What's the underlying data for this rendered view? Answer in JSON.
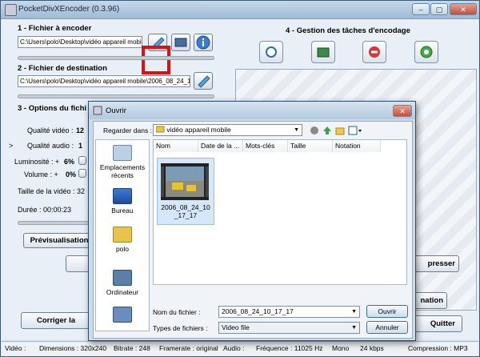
{
  "app": {
    "title": "PocketDivXEncoder (0.3.96)",
    "controls": {
      "min": "‒",
      "max": "▢",
      "close": "✕"
    }
  },
  "section1": {
    "title": "1 - Fichier à encoder",
    "path": "C:\\Users\\polo\\Desktop\\vidéo appareil mobile"
  },
  "section2": {
    "title": "2 - Fichier de destination",
    "path": "C:\\Users\\polo\\Desktop\\vidéo appareil mobile\\2006_08_24_1"
  },
  "section3": {
    "title": "3 - Options du fichi",
    "qualite_video_label": "Qualité vidéo :",
    "qualite_video_val": "12",
    "qualite_audio_label": "Qualité audio :",
    "qualite_audio_val": "1",
    "luminosite_label": "Luminosité : +",
    "luminosite_val": "6%",
    "volume_label": "Volume : +",
    "volume_val": "0%",
    "taille_label": "Taille de la vidéo : 32",
    "duree_label": "Durée : 00:00:23",
    "side_marker": ">"
  },
  "section4": {
    "title": "4 - Gestion des tâches d'encodage"
  },
  "buttons": {
    "previsualisation": "Prévisualisation",
    "corriger": "Corriger la",
    "compresser": "presser",
    "information": "nation",
    "quitter": "Quitter"
  },
  "status": {
    "video": "Vidéo :",
    "dimensions": "Dimensions : 320x240",
    "bitrate": "Bitrate : 248",
    "framerate": "Framerate : original",
    "audio": "Audio :",
    "frequence": "Fréquence : 11025 Hz",
    "mono": "Mono",
    "kbps": "24 kbps",
    "compression": "Compression : MP3"
  },
  "dialog": {
    "title": "Ouvrir",
    "close": "✕",
    "look_in_label": "Regarder dans :",
    "look_in_value": "vidéo appareil mobile",
    "places": [
      "Emplacements récents",
      "Bureau",
      "polo",
      "Ordinateur",
      ""
    ],
    "columns": [
      "Nom",
      "Date de la ...",
      "Mots-clés",
      "Taille",
      "Notation"
    ],
    "file_name": "2006_08_24_10_17_17",
    "filename_label": "Nom du fichier :",
    "filename_value": "2006_08_24_10_17_17",
    "filetype_label": "Types de fichiers :",
    "filetype_value": "Video file",
    "open": "Ouvrir",
    "cancel": "Annuler"
  },
  "colors": {
    "highlight": "#e01010",
    "accent": "#3b5a78"
  }
}
